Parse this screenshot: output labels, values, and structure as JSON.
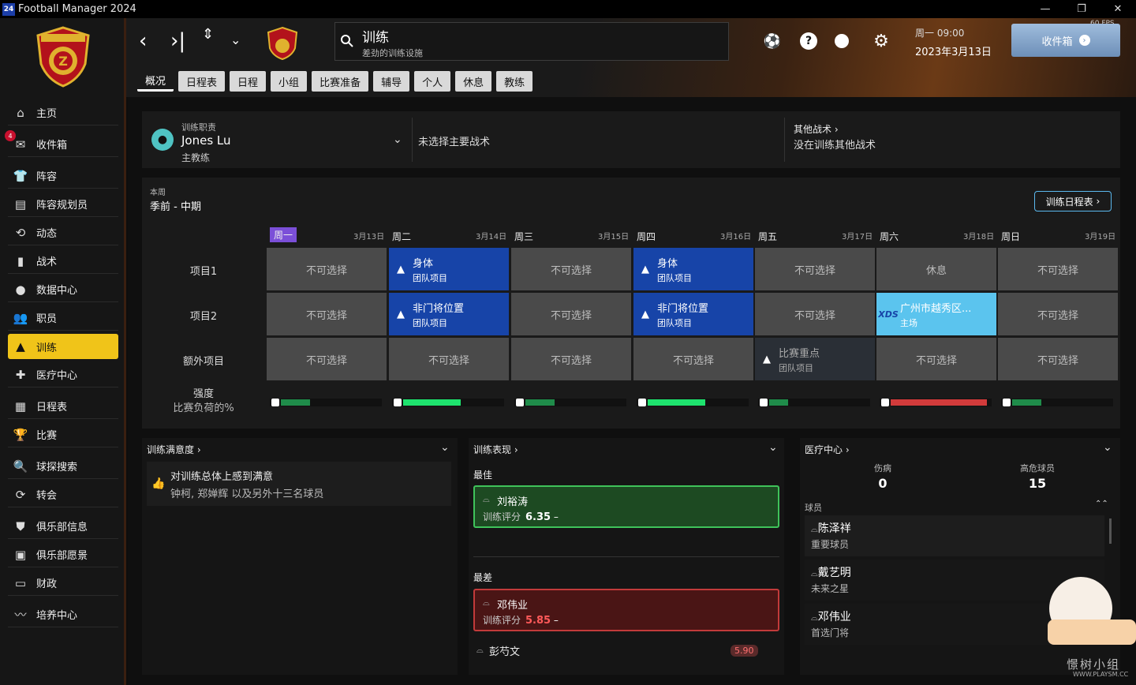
{
  "window": {
    "title": "Football Manager 2024",
    "icon_text": "24",
    "minimize": "—",
    "restore": "❐",
    "close": "✕"
  },
  "sidebar": {
    "items": [
      {
        "label": "主页",
        "icon": "home-icon",
        "glyph": "⌂"
      },
      {
        "label": "收件箱",
        "icon": "inbox-icon",
        "glyph": "✉",
        "badge": "4"
      },
      {
        "label": "阵容",
        "icon": "shirt-icon",
        "glyph": "👕"
      },
      {
        "label": "阵容规划员",
        "icon": "clipboard-icon",
        "glyph": "▤"
      },
      {
        "label": "动态",
        "icon": "dynamics-icon",
        "glyph": "⟲"
      },
      {
        "label": "战术",
        "icon": "tactics-icon",
        "glyph": "▮"
      },
      {
        "label": "数据中心",
        "icon": "data-hub-icon",
        "glyph": "●"
      },
      {
        "label": "职员",
        "icon": "staff-icon",
        "glyph": "👥"
      },
      {
        "label": "训练",
        "icon": "training-cone-icon",
        "glyph": "▲",
        "active": true
      },
      {
        "label": "医疗中心",
        "icon": "medical-icon",
        "glyph": "✚"
      },
      {
        "label": "日程表",
        "icon": "calendar-icon",
        "glyph": "▦"
      },
      {
        "label": "比赛",
        "icon": "trophy-icon",
        "glyph": "🏆"
      },
      {
        "label": "球探搜索",
        "icon": "scouting-icon",
        "glyph": "🔍"
      },
      {
        "label": "转会",
        "icon": "transfers-icon",
        "glyph": "⟳"
      },
      {
        "label": "俱乐部信息",
        "icon": "club-shield-icon",
        "glyph": "⛊"
      },
      {
        "label": "俱乐部愿景",
        "icon": "briefcase-icon",
        "glyph": "▣"
      },
      {
        "label": "财政",
        "icon": "finances-icon",
        "glyph": "▭"
      },
      {
        "label": "培养中心",
        "icon": "development-icon",
        "glyph": "〰"
      }
    ]
  },
  "header": {
    "search_title": "训练",
    "search_subtitle": "差劲的训练设施",
    "date_line1": "周一 09:00",
    "date_line2": "2023年3月13日",
    "inbox_button": "收件箱",
    "fps": "60 FPS"
  },
  "tabs": [
    "概况",
    "日程表",
    "日程",
    "小组",
    "比赛准备",
    "辅导",
    "个人",
    "休息",
    "教练"
  ],
  "coach": {
    "label": "训练职责",
    "name": "Jones Lu",
    "role": "主教练"
  },
  "main_tactic": "未选择主要战术",
  "other": {
    "label": "其他战术",
    "value": "没在训练其他战术"
  },
  "week": {
    "label": "本周",
    "value": "季前 - 中期",
    "schedule_button": "训练日程表"
  },
  "days": [
    {
      "name": "周一",
      "date": "3月13日",
      "current": true
    },
    {
      "name": "周二",
      "date": "3月14日"
    },
    {
      "name": "周三",
      "date": "3月15日"
    },
    {
      "name": "周四",
      "date": "3月16日"
    },
    {
      "name": "周五",
      "date": "3月17日"
    },
    {
      "name": "周六",
      "date": "3月18日"
    },
    {
      "name": "周日",
      "date": "3月19日"
    }
  ],
  "rows": [
    {
      "label": "项目1",
      "cells": [
        {
          "type": "na",
          "a": "不可选择"
        },
        {
          "type": "blue",
          "a": "身体",
          "b": "团队项目"
        },
        {
          "type": "na",
          "a": "不可选择"
        },
        {
          "type": "blue",
          "a": "身体",
          "b": "团队项目"
        },
        {
          "type": "na",
          "a": "不可选择"
        },
        {
          "type": "na",
          "a": "休息"
        },
        {
          "type": "na",
          "a": "不可选择"
        }
      ]
    },
    {
      "label": "项目2",
      "cells": [
        {
          "type": "na",
          "a": "不可选择"
        },
        {
          "type": "blue",
          "a": "非门将位置",
          "b": "团队项目"
        },
        {
          "type": "na",
          "a": "不可选择"
        },
        {
          "type": "blue",
          "a": "非门将位置",
          "b": "团队项目"
        },
        {
          "type": "na",
          "a": "不可选择"
        },
        {
          "type": "lblue",
          "a": "广州市越秀区...",
          "b": "主场",
          "logo": "XDS"
        },
        {
          "type": "na",
          "a": "不可选择"
        }
      ]
    },
    {
      "label": "额外项目",
      "cells": [
        {
          "type": "na",
          "a": "不可选择"
        },
        {
          "type": "na",
          "a": "不可选择"
        },
        {
          "type": "na",
          "a": "不可选择"
        },
        {
          "type": "na",
          "a": "不可选择"
        },
        {
          "type": "dark",
          "a": "比赛重点",
          "b": "团队项目"
        },
        {
          "type": "na",
          "a": "不可选择"
        },
        {
          "type": "na",
          "a": "不可选择"
        }
      ]
    }
  ],
  "intensity": {
    "label1": "强度",
    "label2": "比赛负荷的%",
    "levels": [
      0.3,
      0.6,
      0.3,
      0.6,
      0.2,
      1.0,
      0.3
    ],
    "colors": [
      "#1f8c4a",
      "#1ee36e",
      "#1f8c4a",
      "#1ee36e",
      "#1f8c4a",
      "#d23b3b",
      "#1f8c4a"
    ]
  },
  "satisfaction": {
    "title": "训练满意度",
    "line1": "对训练总体上感到满意",
    "line2": "钟柯, 郑婵辉 以及另外十三名球员"
  },
  "performance": {
    "title": "训练表现",
    "best_label": "最佳",
    "worst_label": "最差",
    "rating_label": "训练评分",
    "best": {
      "name": "刘裕涛",
      "rating": "6.35",
      "trend": "–"
    },
    "worst": {
      "name": "邓伟业",
      "rating": "5.85",
      "trend": "–"
    },
    "next": {
      "name": "彭芍文",
      "rating": "5.90"
    }
  },
  "medical": {
    "title": "医疗中心",
    "injuries_label": "伤病",
    "injuries": "0",
    "risk_label": "高危球员",
    "risk": "15",
    "players_label": "球员",
    "players": [
      {
        "name": "陈泽祥",
        "role": "重要球员"
      },
      {
        "name": "戴艺明",
        "role": "未来之星"
      },
      {
        "name": "邓伟业",
        "role": "首选门将"
      }
    ]
  },
  "watermark": {
    "text": "憬树小组",
    "url": "WWW.PLAYSM.CC"
  }
}
